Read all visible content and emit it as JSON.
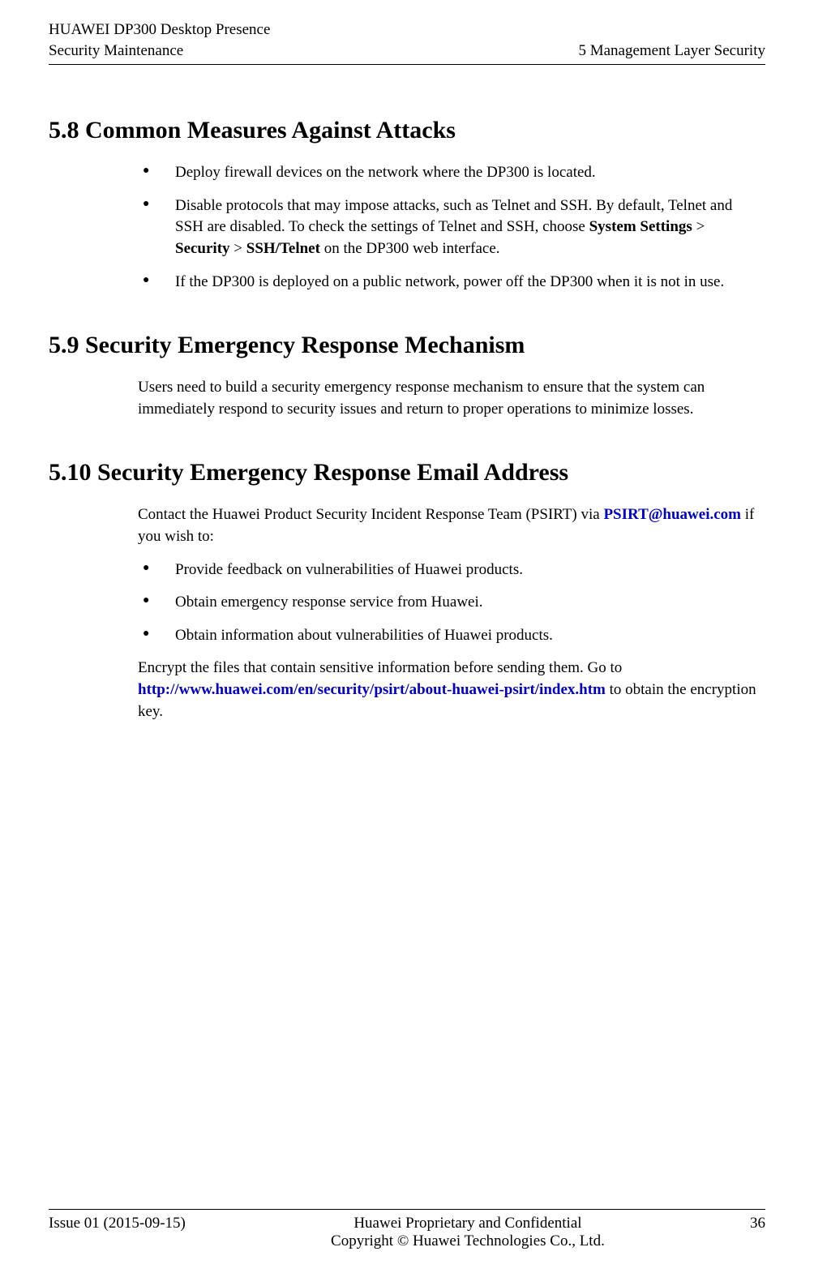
{
  "header": {
    "left_line1": "HUAWEI DP300 Desktop Presence",
    "left_line2": "Security Maintenance",
    "right": "5 Management Layer Security"
  },
  "sections": {
    "s58": {
      "title": "5.8 Common Measures Against Attacks",
      "bullets": {
        "b1": "Deploy firewall devices on the network where the DP300 is located.",
        "b2_pre": "Disable protocols that may impose attacks, such as Telnet and SSH. By default, Telnet and SSH are disabled. To check the settings of Telnet and SSH, choose ",
        "b2_bold1": "System Settings",
        "b2_mid1": " > ",
        "b2_bold2": "Security",
        "b2_mid2": " > ",
        "b2_bold3": "SSH/Telnet",
        "b2_post": " on the DP300 web interface.",
        "b3": "If the DP300 is deployed on a public network, power off the DP300 when it is not in use."
      }
    },
    "s59": {
      "title": "5.9 Security Emergency Response Mechanism",
      "para": "Users need to build a security emergency response mechanism to ensure that the system can immediately respond to security issues and return to proper operations to minimize losses."
    },
    "s510": {
      "title": "5.10 Security Emergency Response Email Address",
      "intro_pre": "Contact the Huawei Product Security Incident Response Team (PSIRT) via ",
      "intro_link": "PSIRT@huawei.com",
      "intro_post": " if you wish to:",
      "bullets": {
        "b1": "Provide feedback on vulnerabilities of Huawei products.",
        "b2": "Obtain emergency response service from Huawei.",
        "b3": "Obtain information about vulnerabilities of Huawei products."
      },
      "outro_pre": "Encrypt the files that contain sensitive information before sending them. Go to ",
      "outro_link": "http://www.huawei.com/en/security/psirt/about-huawei-psirt/index.htm",
      "outro_post": " to obtain the encryption key."
    }
  },
  "footer": {
    "left": "Issue 01 (2015-09-15)",
    "center_line1": "Huawei Proprietary and Confidential",
    "center_line2": "Copyright © Huawei Technologies Co., Ltd.",
    "right": "36"
  }
}
